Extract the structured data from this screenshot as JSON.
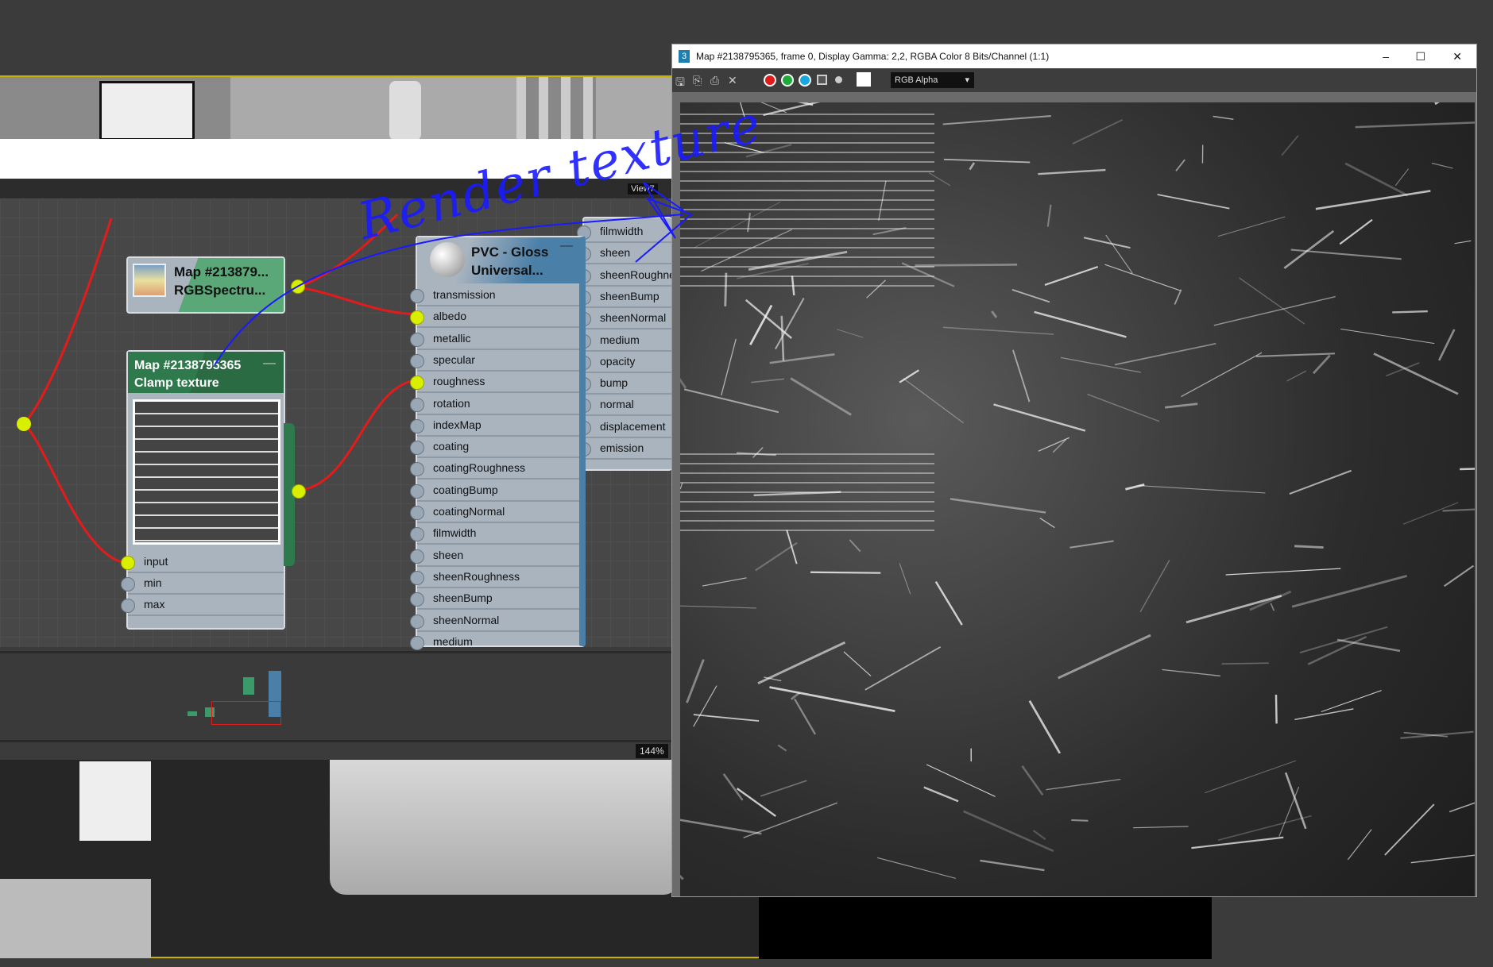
{
  "viewport_top": {
    "label": "View7"
  },
  "nav": {
    "zoom": "144%"
  },
  "nodes": {
    "rgb": {
      "title": "Map  #213879...",
      "subtitle": "RGBSpectru..."
    },
    "clamp": {
      "title": "Map #2138795365",
      "subtitle": "Clamp texture",
      "collapse": "—",
      "inputs": [
        "input",
        "min",
        "max"
      ]
    },
    "pvc": {
      "title": "PVC - Gloss",
      "subtitle": "Universal...",
      "collapse": "—",
      "left_inputs": [
        "transmission",
        "albedo",
        "metallic",
        "specular",
        "roughness",
        "rotation",
        "indexMap",
        "coating",
        "coatingRoughness",
        "coatingBump",
        "coatingNormal",
        "filmwidth",
        "sheen",
        "sheenRoughness",
        "sheenBump",
        "sheenNormal",
        "medium"
      ],
      "right_inputs": [
        "filmwidth",
        "sheen",
        "sheenRoughne",
        "sheenBump",
        "sheenNormal",
        "medium",
        "opacity",
        "bump",
        "normal",
        "displacement",
        "emission"
      ]
    }
  },
  "map_window": {
    "title": "Map #2138795365, frame 0, Display Gamma: 2,2, RGBA Color 8 Bits/Channel (1:1)",
    "app_icon": "3",
    "minimize": "–",
    "maximize": "☐",
    "close": "✕",
    "channel_select": "RGB Alpha",
    "channel_colors": {
      "red": "#e01b1b",
      "green": "#1faa3a",
      "blue": "#1aa7e0"
    }
  },
  "annotation": {
    "handwriting": "Render texture",
    "color": "#1a1aff"
  },
  "colors": {
    "wire": "#e41b1b",
    "socket_active": "#d8f000",
    "node_green": "#2f7a4c",
    "node_blue": "#4a7fa8"
  }
}
